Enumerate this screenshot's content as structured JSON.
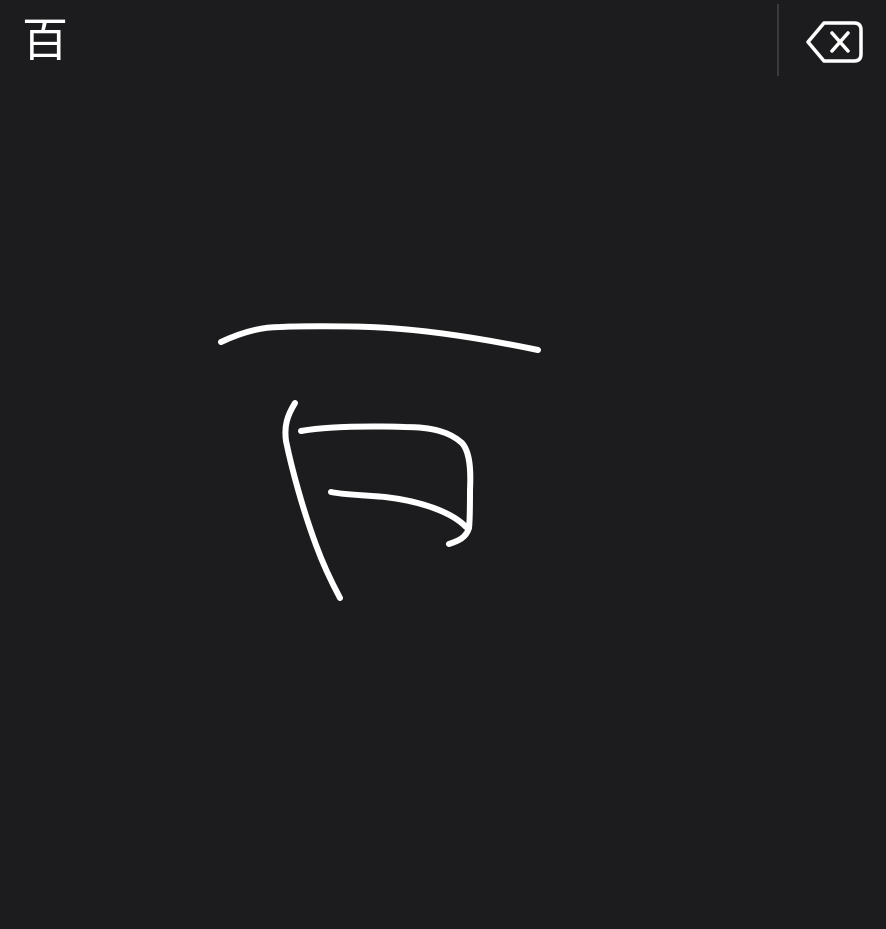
{
  "keyboard": {
    "candidate": "百",
    "delete_icon": "delete-backspace-icon",
    "colors": {
      "background": "#1c1c1e",
      "ink": "#ffffff",
      "divider": "#3a3a3c"
    }
  }
}
